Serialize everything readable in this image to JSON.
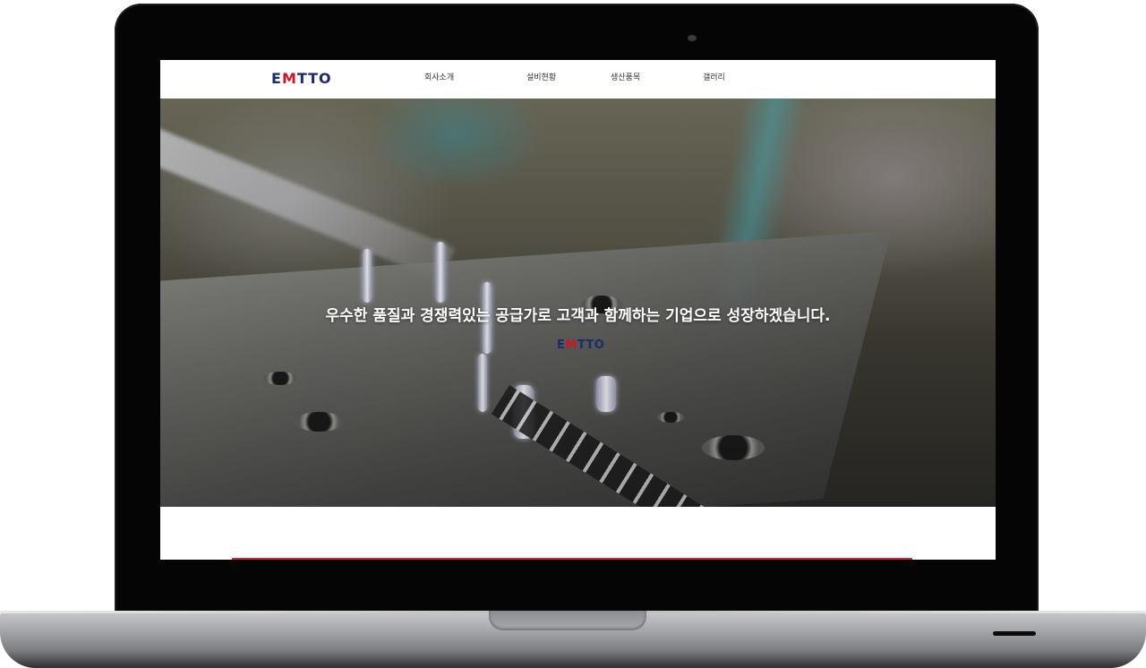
{
  "site": {
    "logo": {
      "e": "E",
      "m": "M",
      "rest": "TTO"
    }
  },
  "nav": {
    "items": [
      {
        "label": "회사소개"
      },
      {
        "label": "설비현황"
      },
      {
        "label": "생산품목"
      },
      {
        "label": "갤러리"
      }
    ]
  },
  "hero": {
    "title": "우수한 품질과 경쟁력있는 공급가로 고객과 함께하는 기업으로 성장하겠습니다.",
    "logo": {
      "e": "E",
      "m": "M",
      "rest": "TTO"
    }
  },
  "colors": {
    "brand_navy": "#1e2a6b",
    "brand_red": "#d3132b",
    "accent_line": "#c0283c"
  },
  "icons": [
    "laptop-camera-icon",
    "laptop-power-light-icon"
  ]
}
